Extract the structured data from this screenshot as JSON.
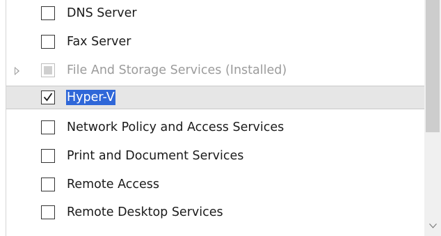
{
  "roles_list": {
    "items": [
      {
        "label": "DNS Server",
        "checked": false,
        "state": "normal"
      },
      {
        "label": "Fax Server",
        "checked": false,
        "state": "normal"
      },
      {
        "label": "File And Storage Services (Installed)",
        "checked": false,
        "state": "installed-partial",
        "expandable": true
      },
      {
        "label": "Hyper-V",
        "checked": true,
        "state": "selected"
      },
      {
        "label": "Network Policy and Access Services",
        "checked": false,
        "state": "normal"
      },
      {
        "label": "Print and Document Services",
        "checked": false,
        "state": "normal"
      },
      {
        "label": "Remote Access",
        "checked": false,
        "state": "normal"
      },
      {
        "label": "Remote Desktop Services",
        "checked": false,
        "state": "normal"
      }
    ]
  },
  "colors": {
    "selection_highlight": "#2f67d8",
    "selected_row_bg": "#e6e6e6",
    "disabled_text": "#9b9b9b"
  },
  "icons": {
    "expander": "triangle-right-outline-icon",
    "scroll_down": "chevron-down-icon",
    "checkmark": "checkmark-icon"
  }
}
